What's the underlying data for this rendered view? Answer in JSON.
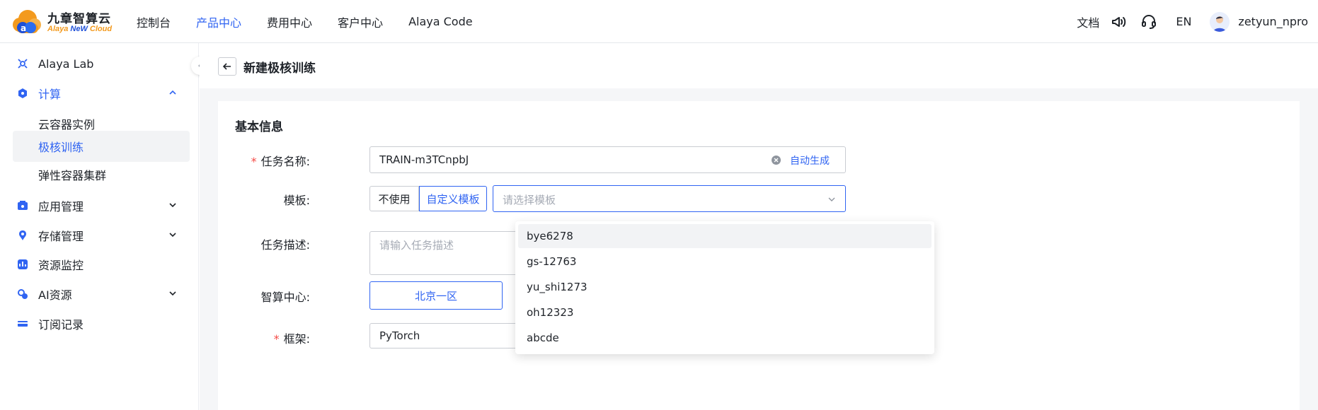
{
  "brand": {
    "title": "九章智算云",
    "subtitle_a": "Alaya ",
    "subtitle_b": "NeW",
    "subtitle_c": " Cloud",
    "accent": "#3064f2"
  },
  "nav": {
    "items": [
      "控制台",
      "产品中心",
      "费用中心",
      "客户中心",
      "Alaya Code"
    ],
    "active_index": 1
  },
  "topright": {
    "docs": "文档",
    "lang": "EN",
    "username": "zetyun_npro",
    "icons": [
      "megaphone-icon",
      "headset-icon"
    ]
  },
  "sidebar": {
    "items": [
      {
        "label": "Alaya Lab",
        "icon": "lab-icon"
      },
      {
        "label": "计算",
        "icon": "compute-icon",
        "expanded": true
      },
      {
        "label": "云容器实例"
      },
      {
        "label": "极核训练",
        "selected": true
      },
      {
        "label": "弹性容器集群"
      },
      {
        "label": "应用管理",
        "icon": "app-icon"
      },
      {
        "label": "存储管理",
        "icon": "storage-icon"
      },
      {
        "label": "资源监控",
        "icon": "monitor-icon"
      },
      {
        "label": "AI资源",
        "icon": "ai-icon"
      },
      {
        "label": "订阅记录",
        "icon": "subscription-icon"
      }
    ]
  },
  "page": {
    "title": "新建极核训练"
  },
  "form": {
    "section_title": "基本信息",
    "task_name": {
      "label": "任务名称:",
      "value": "TRAIN-m3TCnpbJ",
      "action": "自动生成",
      "required": true
    },
    "template": {
      "label": "模板:",
      "options": [
        "不使用",
        "自定义模板"
      ],
      "selected": "自定义模板",
      "placeholder": "请选择模板"
    },
    "description": {
      "label": "任务描述:",
      "placeholder": "请输入任务描述"
    },
    "center": {
      "label": "智算中心:",
      "value": "北京一区"
    },
    "framework": {
      "label": "框架:",
      "value": "PyTorch",
      "required": true
    }
  },
  "dropdown": {
    "options": [
      "bye6278",
      "gs-12763",
      "yu_shi1273",
      "oh12323",
      "abcde"
    ],
    "hover_index": 0
  }
}
